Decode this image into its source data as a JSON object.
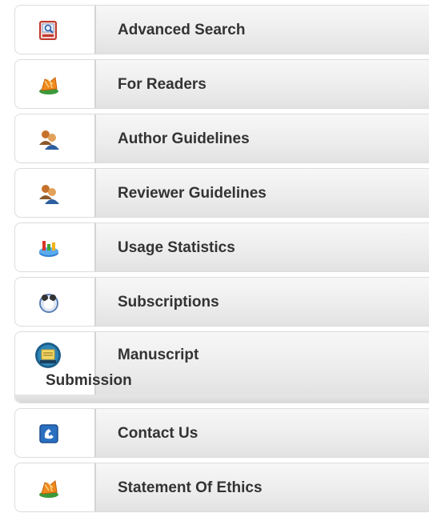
{
  "menu": {
    "items": [
      {
        "label": "Advanced Search",
        "icon": "advanced-search-icon"
      },
      {
        "label": "For Readers",
        "icon": "readers-icon"
      },
      {
        "label": "Author Guidelines",
        "icon": "authors-icon"
      },
      {
        "label": "Reviewer Guidelines",
        "icon": "reviewers-icon"
      },
      {
        "label": "Usage Statistics",
        "icon": "statistics-icon"
      },
      {
        "label": "Subscriptions",
        "icon": "subscriptions-icon"
      },
      {
        "label_line1": "Manuscript",
        "label_line2": "Submission",
        "icon": "manuscript-icon"
      },
      {
        "label": "Contact Us",
        "icon": "contact-icon"
      },
      {
        "label": "Statement Of Ethics",
        "icon": "ethics-icon"
      }
    ]
  }
}
